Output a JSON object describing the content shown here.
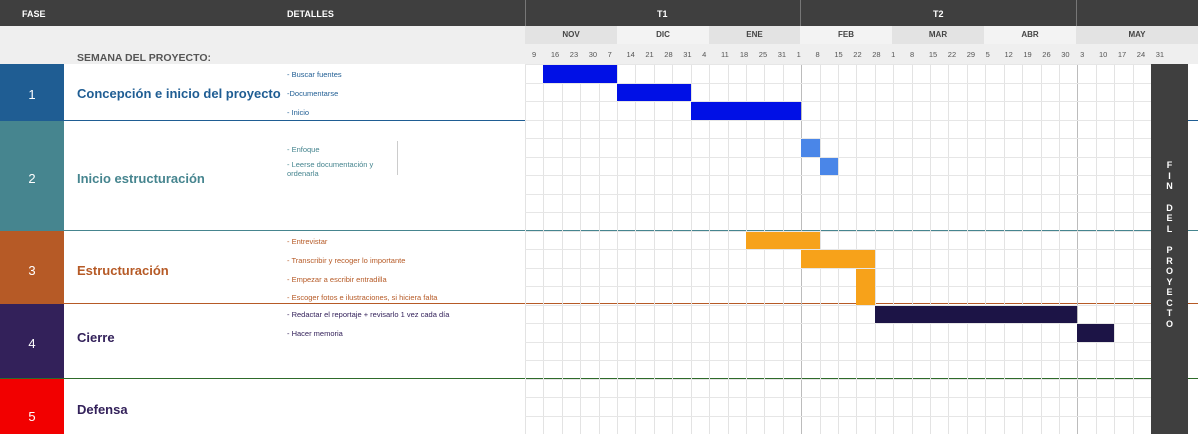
{
  "header": {
    "fase": "FASE",
    "detalles": "DETALLES",
    "t1": "T1",
    "t2": "T2"
  },
  "months": [
    "NOV",
    "DIC",
    "ENE",
    "FEB",
    "MAR",
    "ABR",
    "MAY"
  ],
  "weeks": [
    "9",
    "16",
    "23",
    "30",
    "7",
    "14",
    "21",
    "28",
    "31",
    "4",
    "11",
    "18",
    "25",
    "31",
    "1",
    "8",
    "15",
    "22",
    "28",
    "1",
    "8",
    "15",
    "22",
    "29",
    "5",
    "12",
    "19",
    "26",
    "30",
    "3",
    "10",
    "17",
    "24",
    "31"
  ],
  "semana_label": "SEMANA DEL PROYECTO:",
  "phases": [
    {
      "num": "1",
      "title": "Concepción e inicio del proyecto",
      "color": "#1f5d93",
      "title_color": "#1f5d93",
      "details": [
        "- Buscar fuentes",
        "-Documentarse",
        "- Inicio"
      ]
    },
    {
      "num": "2",
      "title": "Inicio estructuración",
      "color": "#46858f",
      "title_color": "#46858f",
      "details": [
        "- Enfoque",
        "- Leerse documentación y ordenarla"
      ]
    },
    {
      "num": "3",
      "title": "Estructuración",
      "color": "#b65a26",
      "title_color": "#b65a26",
      "details": [
        "- Entrevistar",
        "- Transcribir y recoger lo importante",
        "- Empezar a escribir entradilla",
        "- Escoger fotos e ilustraciones, si hiciera falta"
      ]
    },
    {
      "num": "4",
      "title": "Cierre",
      "color": "#33215a",
      "title_color": "#33215a",
      "details": [
        "- Redactar el reportaje + revisarlo 1 vez cada día",
        "- Hacer memoria"
      ]
    },
    {
      "num": "5",
      "title": "Defensa",
      "color": "#f20000",
      "title_color": "#33215a",
      "details": []
    }
  ],
  "colors": {
    "blue": "#0010e6",
    "lightblue": "#4a86e8",
    "orange": "#f7a21a",
    "navy": "#1c1446",
    "dark": "#3f3f3f"
  },
  "end_label": "FIN DEL PROYECTO"
}
